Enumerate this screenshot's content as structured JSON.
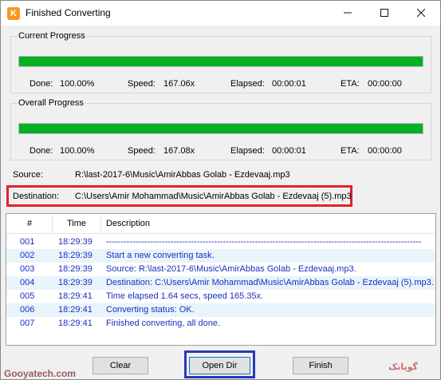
{
  "window": {
    "title": "Finished Converting",
    "icon_letter": "K",
    "icon_color": "#f59a1a",
    "min_icon": "minimize-icon",
    "max_icon": "maximize-icon",
    "close_icon": "close-icon"
  },
  "current_progress": {
    "label": "Current Progress",
    "progress": 1.0,
    "done_label": "Done:",
    "done_value": "100.00%",
    "speed_label": "Speed:",
    "speed_value": "167.06x",
    "elapsed_label": "Elapsed:",
    "elapsed_value": "00:00:01",
    "eta_label": "ETA:",
    "eta_value": "00:00:00"
  },
  "overall_progress": {
    "label": "Overall Progress",
    "progress": 1.0,
    "done_label": "Done:",
    "done_value": "100.00%",
    "speed_label": "Speed:",
    "speed_value": "167.08x",
    "elapsed_label": "Elapsed:",
    "elapsed_value": "00:00:01",
    "eta_label": "ETA:",
    "eta_value": "00:00:00"
  },
  "source": {
    "label": "Source:",
    "value": "R:\\last-2017-6\\Music\\AmirAbbas Golab - Ezdevaaj.mp3"
  },
  "destination": {
    "label": "Destination:",
    "value": "C:\\Users\\Amir Mohammad\\Music\\AmirAbbas Golab - Ezdevaaj (5).mp3"
  },
  "log": {
    "columns": [
      "#",
      "Time",
      "Description"
    ],
    "rows": [
      {
        "num": "001",
        "time": "18:29:39",
        "desc": "------------------------------------------------------------------------------------------------------------"
      },
      {
        "num": "002",
        "time": "18:29:39",
        "desc": "Start a new converting task."
      },
      {
        "num": "003",
        "time": "18:29:39",
        "desc": "Source:  R:\\last-2017-6\\Music\\AmirAbbas Golab - Ezdevaaj.mp3."
      },
      {
        "num": "004",
        "time": "18:29:39",
        "desc": "Destination: C:\\Users\\Amir Mohammad\\Music\\AmirAbbas Golab - Ezdevaaj (5).mp3."
      },
      {
        "num": "005",
        "time": "18:29:41",
        "desc": "Time elapsed 1.64 secs, speed 165.35x."
      },
      {
        "num": "006",
        "time": "18:29:41",
        "desc": "Converting status: OK."
      },
      {
        "num": "007",
        "time": "18:29:41",
        "desc": "Finished converting, all done."
      }
    ]
  },
  "buttons": {
    "clear": "Clear",
    "open_dir": "Open Dir",
    "finish": "Finish"
  },
  "watermark": {
    "left": "Gooyatech.com",
    "right": "گویاتک"
  },
  "colors": {
    "progress_green": "#06b025",
    "log_text": "#1a2fbf",
    "highlight_red": "#e3212d",
    "highlight_blue": "#2b37b8"
  }
}
